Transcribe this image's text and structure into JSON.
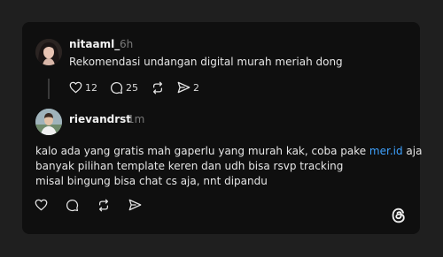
{
  "thread": {
    "post": {
      "username": "nitaaml_",
      "time": "6h",
      "text": "Rekomendasi undangan digital murah meriah dong",
      "likes": "12",
      "replies": "25",
      "shares": "2"
    },
    "reply": {
      "username": "rievandrst",
      "time": "1m",
      "line1_before": "kalo ada yang gratis mah gaperlu yang murah kak, coba pake ",
      "line1_link": "mer.id",
      "line1_after": " aja",
      "line2": "banyak pilihan template keren dan udh bisa rsvp tracking",
      "line3": "misal bingung bisa chat cs aja, nnt dipandu"
    }
  },
  "colors": {
    "background": "#1f1f1f",
    "card": "#0f0f0f",
    "link": "#3ea2ff",
    "muted": "#7a7a7a"
  },
  "icons": [
    "heart-icon",
    "comment-icon",
    "repost-icon",
    "share-icon",
    "threads-logo-icon"
  ]
}
